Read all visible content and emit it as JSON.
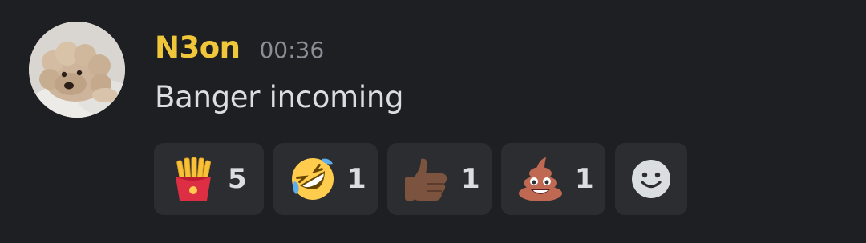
{
  "message": {
    "author": "N3on",
    "timestamp": "00:36",
    "text": "Banger incoming",
    "author_color": "#f0c63a"
  },
  "reactions": [
    {
      "emoji": "french-fries",
      "count": "5"
    },
    {
      "emoji": "rolling-on-the-floor-laughing",
      "count": "1"
    },
    {
      "emoji": "thumbs-up-dark-skin",
      "count": "1"
    },
    {
      "emoji": "pile-of-poo",
      "count": "1"
    }
  ],
  "add_reaction": {
    "icon": "smiley-face-icon"
  },
  "colors": {
    "background": "#1e1f22",
    "reaction_bg": "#2b2d31",
    "text": "#dcdde0",
    "timestamp": "#8b8e96"
  }
}
